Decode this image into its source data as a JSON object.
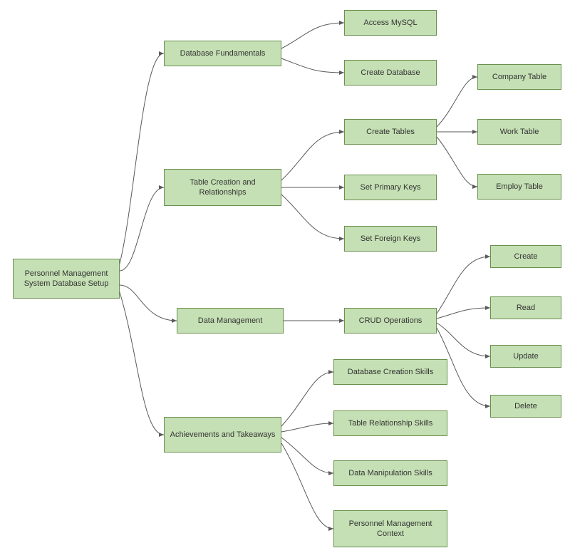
{
  "nodes": {
    "root": "Personnel Management System Database Setup",
    "db_fund": "Database Fundamentals",
    "access_mysql": "Access MySQL",
    "create_db": "Create Database",
    "table_rel": "Table Creation and Relationships",
    "create_tables": "Create Tables",
    "set_pk": "Set Primary Keys",
    "set_fk": "Set Foreign Keys",
    "company_table": "Company Table",
    "work_table": "Work Table",
    "employ_table": "Employ Table",
    "data_mgmt": "Data Management",
    "crud": "CRUD Operations",
    "create": "Create",
    "read": "Read",
    "update": "Update",
    "delete": "Delete",
    "achievements": "Achievements and Takeaways",
    "db_creation_skills": "Database Creation Skills",
    "table_rel_skills": "Table Relationship Skills",
    "data_manip_skills": "Data Manipulation Skills",
    "pm_context": "Personnel Management Context"
  },
  "colors": {
    "node_fill": "#c5e0b4",
    "node_stroke": "#6a8f4f",
    "edge": "#5a5a5a"
  }
}
